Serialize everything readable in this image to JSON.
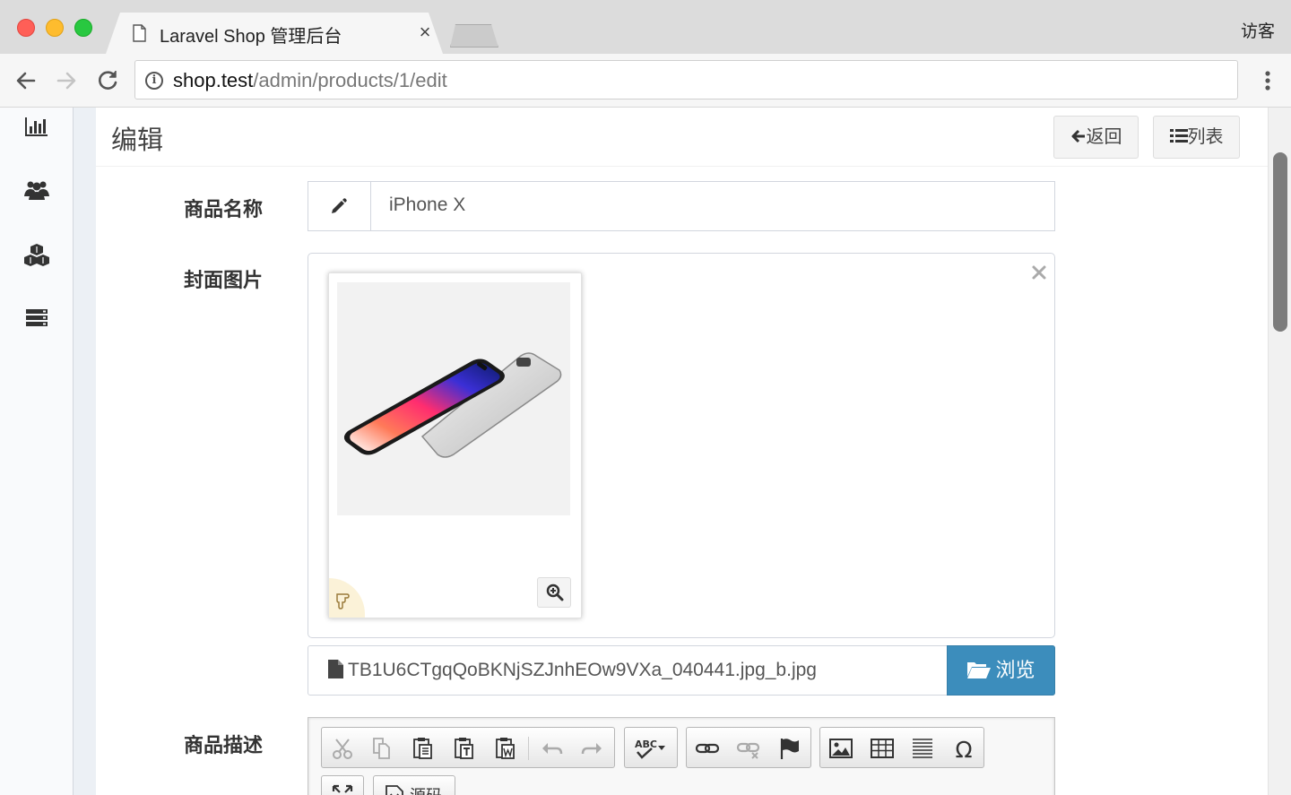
{
  "browser": {
    "tab_title": "Laravel Shop 管理后台",
    "tab_close": "×",
    "profile_label": "访客",
    "url_host": "shop.test",
    "url_path": "/admin/products/1/edit",
    "info_icon": "i"
  },
  "sidebar": {
    "icons": [
      "bar-chart-icon",
      "users-icon",
      "cubes-icon",
      "server-icon"
    ]
  },
  "page": {
    "title": "编辑",
    "back_button": "返回",
    "list_button": "列表"
  },
  "form": {
    "name_label": "商品名称",
    "name_value": "iPhone X",
    "cover_label": "封面图片",
    "file_name": "TB1U6CTgqQoBKNjSZJnhEOw9VXa_040441.jpg_b.jpg",
    "browse_button": "浏览",
    "description_label": "商品描述",
    "source_button": "源码"
  },
  "colors": {
    "primary": "#3c8dbc",
    "panel_bg": "#ffffff",
    "content_bg": "#ecf0f5"
  }
}
